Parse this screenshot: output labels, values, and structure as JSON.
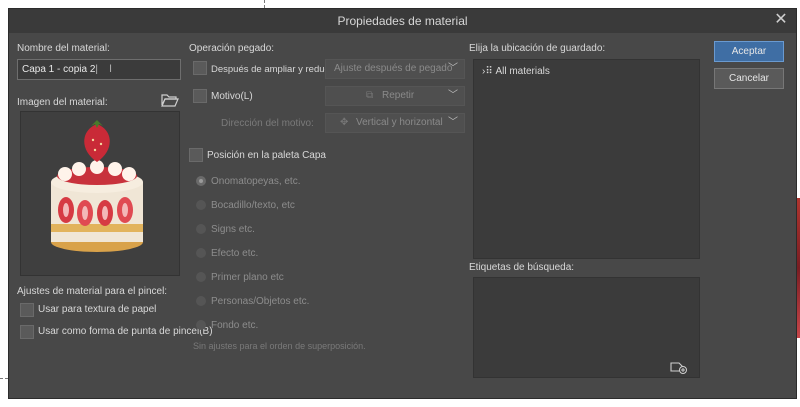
{
  "window": {
    "title": "Propiedades de material"
  },
  "left": {
    "name_label": "Nombre del material:",
    "name_value": "Capa 1 - copia 2",
    "image_label": "Imagen del material:",
    "brush_settings_label": "Ajustes de material para el pincel:",
    "paper_texture_label": "Usar para textura de papel",
    "brush_tip_label": "Usar como forma de punta de pincel(B)"
  },
  "paste": {
    "section_label": "Operación pegado:",
    "scale_label": "Después de ampliar y reducir",
    "scale_combo": "Ajuste después de pegado",
    "pattern_label": "Motivo(L)",
    "pattern_combo": "Repetir",
    "direction_label": "Dirección del motivo:",
    "direction_combo": "Vertical y horizontal",
    "layer_position_label": "Posición en la paleta Capa",
    "radio_options": [
      "Onomatopeyas, etc.",
      "Bocadillo/texto, etc",
      "Signs etc.",
      "Efecto etc.",
      "Primer plano etc",
      "Personas/Objetos etc.",
      "Fondo etc."
    ],
    "no_order_note": "Sin ajustes para el orden de superposición."
  },
  "save": {
    "location_label": "Elija la ubicación de guardado:",
    "tree_item": "All materials",
    "tags_label": "Etiquetas de búsqueda:"
  },
  "buttons": {
    "ok": "Aceptar",
    "cancel": "Cancelar"
  },
  "colors": {
    "dialog_bg": "#484848",
    "panel_bg": "#3b3b3b",
    "accent": "#3f6ea4"
  },
  "icons": [
    "close-icon",
    "folder-open-icon",
    "pattern-icon",
    "direction-icon",
    "tree-node-icon",
    "add-tag-icon",
    "chevron-down-icon"
  ]
}
